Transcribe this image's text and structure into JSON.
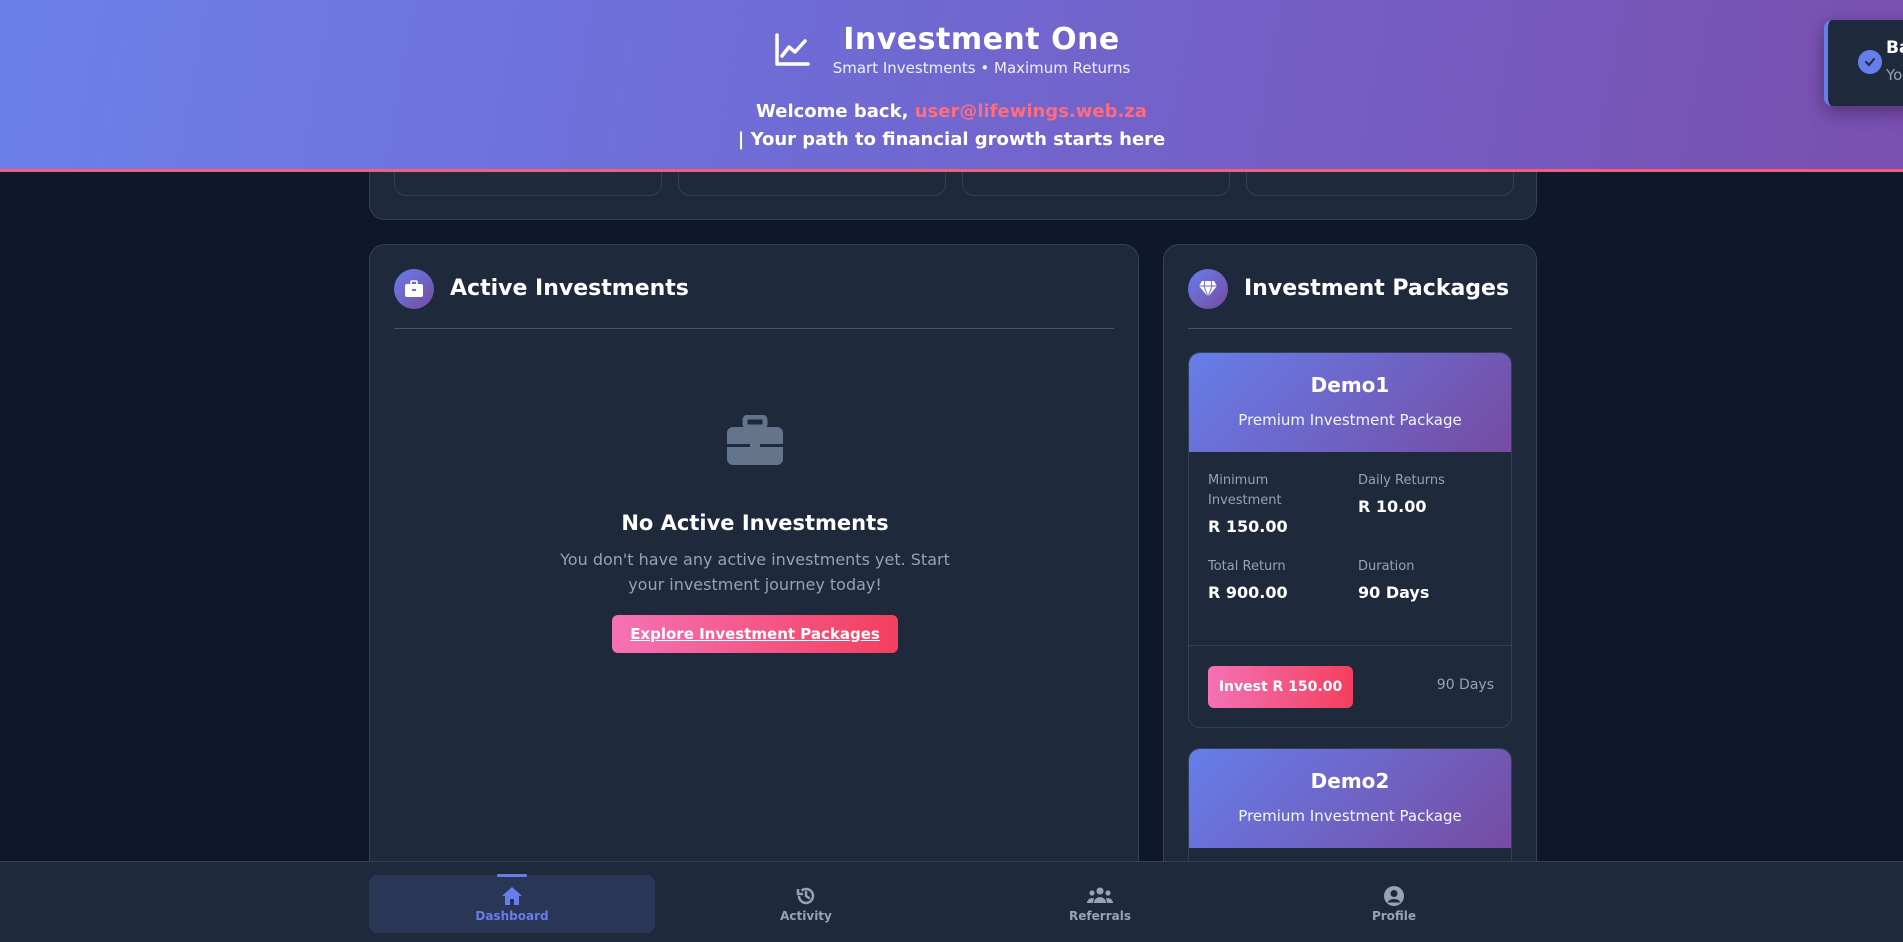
{
  "header": {
    "title": "Investment One",
    "subtitle": "Smart Investments • Maximum Returns",
    "welcome_prefix": "Welcome back,",
    "email": "user@lifewings.web.za",
    "welcome_suffix": "| Your path to financial growth starts here",
    "icon": "chart-line-icon"
  },
  "toast": {
    "title": "Ba",
    "message": "Yo",
    "icon": "check-circle-icon"
  },
  "active_investments": {
    "title": "Active Investments",
    "icon": "briefcase-icon",
    "empty_title": "No Active Investments",
    "empty_text": "You don't have any active investments yet. Start your investment journey today!",
    "explore_label": "Explore Investment Packages"
  },
  "packages": {
    "title": "Investment Packages",
    "icon": "gem-icon",
    "items": [
      {
        "name": "Demo1",
        "description": "Premium Investment Package",
        "min_label": "Minimum Investment",
        "min_value": "R 150.00",
        "daily_label": "Daily Returns",
        "daily_value": "R 10.00",
        "total_label": "Total Return",
        "total_value": "R 900.00",
        "duration_label": "Duration",
        "duration_value": "90 Days",
        "invest_label": "Invest R 150.00",
        "footer_duration": "90 Days"
      },
      {
        "name": "Demo2",
        "description": "Premium Investment Package"
      }
    ]
  },
  "nav": {
    "items": [
      {
        "label": "Dashboard",
        "icon": "home-icon",
        "active": true
      },
      {
        "label": "Activity",
        "icon": "history-icon",
        "active": false
      },
      {
        "label": "Referrals",
        "icon": "users-icon",
        "active": false
      },
      {
        "label": "Profile",
        "icon": "user-circle-icon",
        "active": false
      }
    ]
  },
  "colors": {
    "accent": "#667eea",
    "accent2": "#764ba2",
    "pink": "#f472b6",
    "rose": "#f43f5e",
    "background": "#0f172a",
    "card": "#1e293b"
  }
}
